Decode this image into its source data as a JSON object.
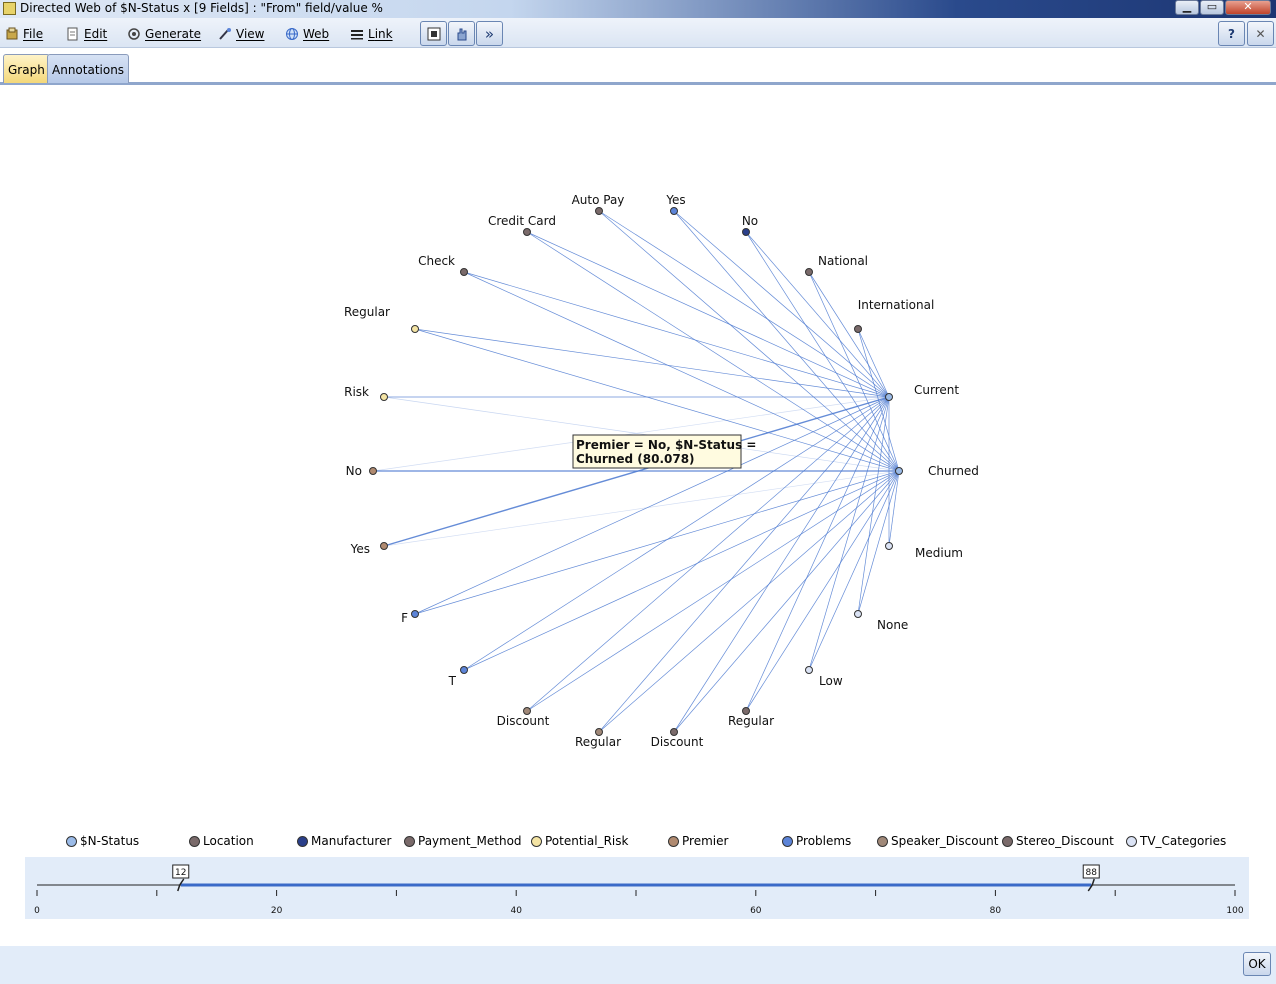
{
  "window": {
    "title": "Directed Web of $N-Status x [9 Fields] : \"From\" field/value %",
    "minimize": "▁",
    "restore": "▭",
    "close": "✕"
  },
  "menu": {
    "items": [
      {
        "label": "File",
        "icon": "file-icon"
      },
      {
        "label": "Edit",
        "icon": "edit-icon"
      },
      {
        "label": "Generate",
        "icon": "generate-icon"
      },
      {
        "label": "View",
        "icon": "view-icon"
      },
      {
        "label": "Web",
        "icon": "web-icon"
      },
      {
        "label": "Link",
        "icon": "link-icon"
      }
    ],
    "more_glyph": "»",
    "help_glyph": "?",
    "close_glyph": "✕"
  },
  "tabs": [
    {
      "label": "Graph",
      "active": true
    },
    {
      "label": "Annotations",
      "active": false
    }
  ],
  "graph": {
    "tooltip": {
      "line1": "Premier = No, $N-Status =",
      "line2": "Churned (80.078)"
    },
    "nodes": [
      {
        "id": "autopay",
        "label": "Auto Pay",
        "field": "Payment_Method"
      },
      {
        "id": "yes_top",
        "label": "Yes",
        "field": "Problems"
      },
      {
        "id": "no_top",
        "label": "No",
        "field": "Manufacturer"
      },
      {
        "id": "creditcard",
        "label": "Credit Card",
        "field": "Payment_Method"
      },
      {
        "id": "national",
        "label": "National",
        "field": "Location"
      },
      {
        "id": "check",
        "label": "Check",
        "field": "Payment_Method"
      },
      {
        "id": "international",
        "label": "International",
        "field": "Location"
      },
      {
        "id": "regular_risk",
        "label": "Regular",
        "field": "Potential_Risk"
      },
      {
        "id": "risk",
        "label": "Risk",
        "field": "Potential_Risk"
      },
      {
        "id": "current",
        "label": "Current",
        "field": "$N-Status"
      },
      {
        "id": "no_left",
        "label": "No",
        "field": "Premier"
      },
      {
        "id": "churned",
        "label": "Churned",
        "field": "$N-Status"
      },
      {
        "id": "yes_left",
        "label": "Yes",
        "field": "Premier"
      },
      {
        "id": "medium",
        "label": "Medium",
        "field": "TV_Categories"
      },
      {
        "id": "f",
        "label": "F",
        "field": "Problems"
      },
      {
        "id": "none",
        "label": "None",
        "field": "TV_Categories"
      },
      {
        "id": "t",
        "label": "T",
        "field": "Problems"
      },
      {
        "id": "low",
        "label": "Low",
        "field": "TV_Categories"
      },
      {
        "id": "discount_a",
        "label": "Discount",
        "field": "Speaker_Discount"
      },
      {
        "id": "regular_b",
        "label": "Regular",
        "field": "Speaker_Discount"
      },
      {
        "id": "discount_b",
        "label": "Discount",
        "field": "Stereo_Discount"
      },
      {
        "id": "regular_c",
        "label": "Regular",
        "field": "Stereo_Discount"
      }
    ]
  },
  "legend": [
    {
      "label": "$N-Status",
      "color": "#9bbbe8"
    },
    {
      "label": "Location",
      "color": "#7a6a6a"
    },
    {
      "label": "Manufacturer",
      "color": "#2a3f8a"
    },
    {
      "label": "Payment_Method",
      "color": "#7a6a6a"
    },
    {
      "label": "Potential_Risk",
      "color": "#f4e4a4"
    },
    {
      "label": "Premier",
      "color": "#b08a70"
    },
    {
      "label": "Problems",
      "color": "#5c84d8"
    },
    {
      "label": "Speaker_Discount",
      "color": "#a08878"
    },
    {
      "label": "Stereo_Discount",
      "color": "#7a6a6a"
    },
    {
      "label": "TV_Categories",
      "color": "#dbe3f5"
    }
  ],
  "slider": {
    "min_value": "12",
    "max_value": "88",
    "ticks": [
      "0",
      "20",
      "40",
      "60",
      "80",
      "100"
    ]
  },
  "footer": {
    "ok_label": "OK"
  },
  "colors": {
    "accent": "#3a6ac8",
    "panel": "#e2ecf9"
  }
}
